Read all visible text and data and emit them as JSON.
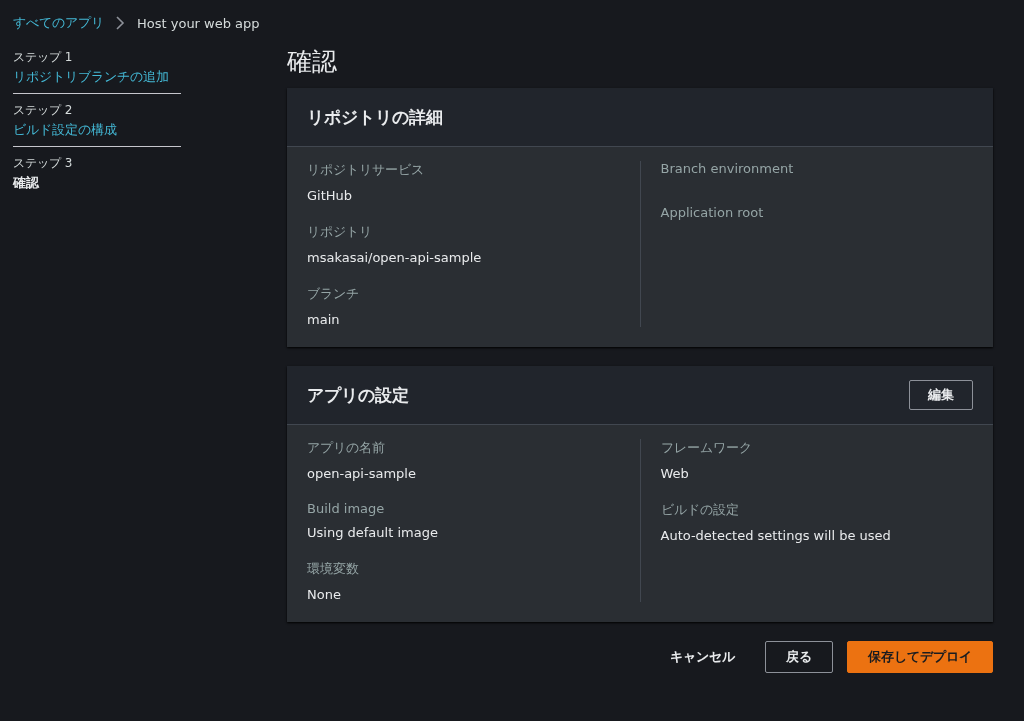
{
  "breadcrumb": {
    "link": "すべてのアプリ",
    "current": "Host your web app"
  },
  "steps": [
    {
      "label": "ステップ 1",
      "title": "リポジトリブランチの追加",
      "selected": false
    },
    {
      "label": "ステップ 2",
      "title": "ビルド設定の構成",
      "selected": false
    },
    {
      "label": "ステップ 3",
      "title": "確認",
      "selected": true
    }
  ],
  "page_title": "確認",
  "panels": [
    {
      "title": "リポジトリの詳細",
      "columns": [
        [
          {
            "label": "リポジトリサービス",
            "value": "GitHub"
          },
          {
            "label": "リポジトリ",
            "value": "msakasai/open-api-sample"
          },
          {
            "label": "ブランチ",
            "value": "main"
          }
        ],
        [
          {
            "label": "Branch environment"
          },
          {
            "label": "Application root"
          }
        ]
      ]
    },
    {
      "title": "アプリの設定",
      "edit_button": "編集",
      "columns": [
        [
          {
            "label": "アプリの名前",
            "value": "open-api-sample"
          },
          {
            "label": "Build image",
            "value": "Using default image"
          },
          {
            "label": "環境変数",
            "value": "None"
          }
        ],
        [
          {
            "label": "フレームワーク",
            "value": "Web"
          },
          {
            "label": "ビルドの設定",
            "value": "Auto-detected settings will be used"
          }
        ]
      ]
    }
  ],
  "actions": {
    "cancel": "キャンセル",
    "back": "戻る",
    "submit": "保存してデプロイ"
  }
}
